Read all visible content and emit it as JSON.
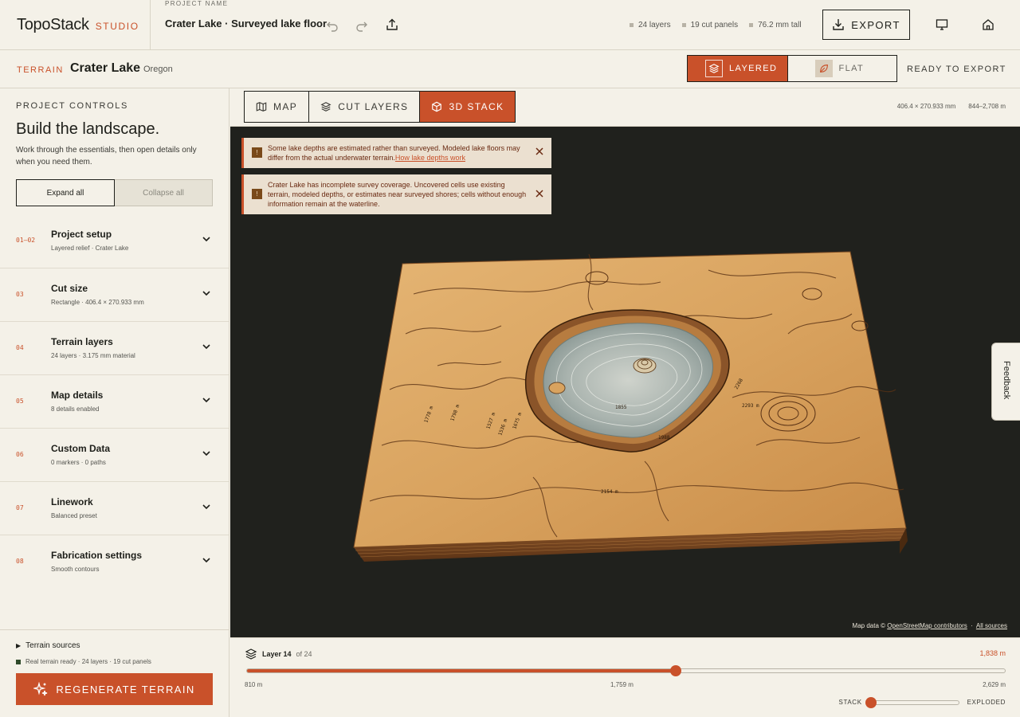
{
  "app": {
    "brand": "TopoStack",
    "brand_suffix": "STUDIO"
  },
  "header": {
    "project_label": "PROJECT NAME",
    "project_title": "Crater Lake · Surveyed lake floor",
    "stats": [
      "24 layers",
      "19 cut panels",
      "76.2 mm tall"
    ],
    "export_label": "EXPORT"
  },
  "subheader": {
    "terrain_label": "TERRAIN",
    "lake_name": "Crater Lake",
    "lake_state": "Oregon",
    "mode_layered": "LAYERED",
    "mode_flat": "FLAT",
    "ready_label": "READY TO EXPORT"
  },
  "sidebar": {
    "eyebrow": "PROJECT CONTROLS",
    "title": "Build the landscape.",
    "description": "Work through the essentials, then open details only when you need them.",
    "expand_all": "Expand all",
    "collapse_all": "Collapse all",
    "sections": [
      {
        "num": "01–02",
        "title": "Project setup",
        "sub": "Layered relief · Crater Lake"
      },
      {
        "num": "03",
        "title": "Cut size",
        "sub": "Rectangle · 406.4 × 270.933 mm"
      },
      {
        "num": "04",
        "title": "Terrain layers",
        "sub": "24 layers · 3.175 mm material"
      },
      {
        "num": "05",
        "title": "Map details",
        "sub": "8 details enabled"
      },
      {
        "num": "06",
        "title": "Custom Data",
        "sub": "0 markers · 0 paths"
      },
      {
        "num": "07",
        "title": "Linework",
        "sub": "Balanced preset"
      },
      {
        "num": "08",
        "title": "Fabrication settings",
        "sub": "Smooth contours"
      }
    ],
    "sources_label": "Terrain sources",
    "ready_status": "Real terrain ready · 24 layers · 19 cut panels",
    "regen_label": "REGENERATE TERRAIN"
  },
  "main": {
    "tabs": [
      "MAP",
      "CUT LAYERS",
      "3D STACK"
    ],
    "active_tab": 2,
    "dims": [
      "406.4 × 270.933 mm",
      "844–2,708 m"
    ],
    "warnings": [
      {
        "text": "Some lake depths are estimated rather than surveyed. Modeled lake floors may differ from the actual underwater terrain.",
        "link": "How lake depths work"
      },
      {
        "text": "Crater Lake has incomplete survey coverage. Uncovered cells use existing terrain, modeled depths, or estimates near surveyed shores; cells without enough information remain at the waterline.",
        "link": ""
      }
    ],
    "attribution_prefix": "Map data © ",
    "attribution_osm": "OpenStreetMap contributors",
    "attribution_sources": "All sources",
    "contour_labels": [
      "1855",
      "2154 m",
      "2293 m",
      "1778 m",
      "1798 m",
      "1527 m",
      "1536 m",
      "1675 m",
      "2268",
      "1988"
    ],
    "feedback_label": "Feedback"
  },
  "layer_slider": {
    "layer_label": "Layer 14",
    "of_label": "of 24",
    "current_layer": 14,
    "total_layers": 24,
    "current_elev": "1,838 m",
    "min_label": "810 m",
    "mid_label": "1,759 m",
    "max_label": "2,629 m",
    "explode_stack": "STACK",
    "explode_exploded": "EXPLODED",
    "explode_fraction": 0
  },
  "colors": {
    "accent": "#c9512a",
    "ink": "#1e1f1a",
    "paper": "#f4f1e8",
    "viewport": "#20211d",
    "terrain": "#d9a35f",
    "lake": "#a9b3ae"
  }
}
